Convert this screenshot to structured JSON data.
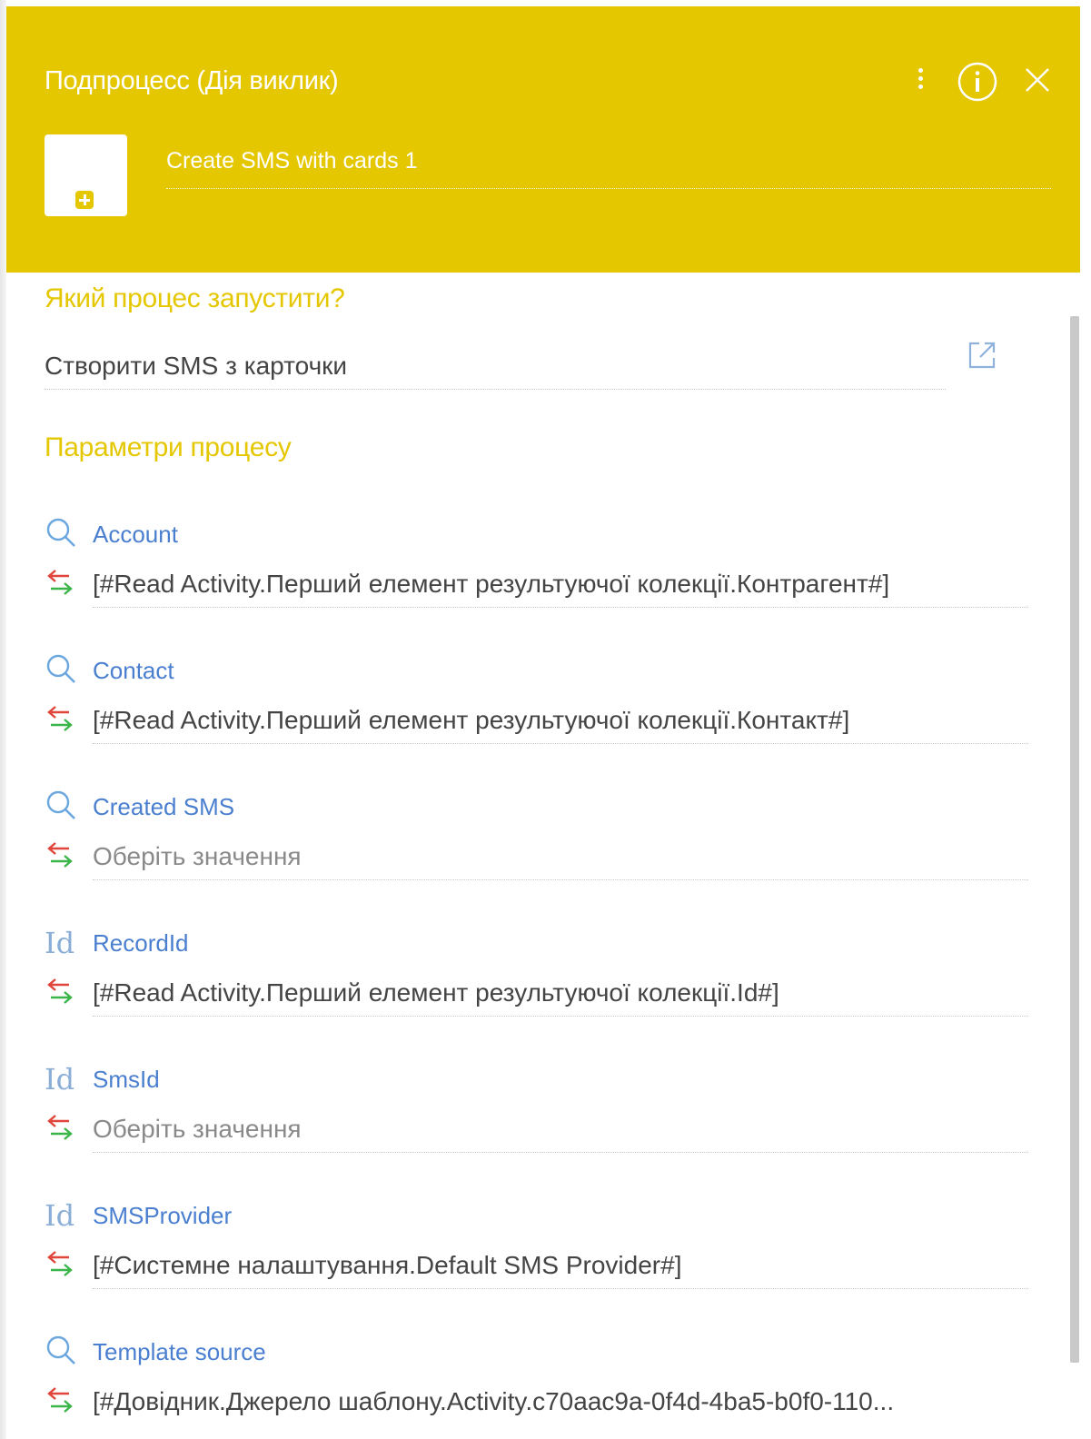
{
  "header": {
    "title": "Подпроцесс (Дія виклик)",
    "element_name": "Create SMS with cards 1",
    "background_color": "#e5c700",
    "icons": [
      "menu-dots-icon",
      "info-icon",
      "close-icon",
      "add-element-icon"
    ]
  },
  "process_section": {
    "title": "Який процес запустити?",
    "selected_process": "Створити SMS з карточки",
    "open_icon": "open-external-icon"
  },
  "parameters_section": {
    "title": "Параметри процесу",
    "params": [
      {
        "name": "Account",
        "icon": "search-icon",
        "value": "[#Read Activity.Перший елемент результуючої колекції.Контрагент#]",
        "placeholder": false
      },
      {
        "name": "Contact",
        "icon": "search-icon",
        "value": "[#Read Activity.Перший елемент результуючої колекції.Контакт#]",
        "placeholder": false
      },
      {
        "name": "Created SMS",
        "icon": "search-icon",
        "value": "Оберіть значення",
        "placeholder": true
      },
      {
        "name": "RecordId",
        "icon": "id-icon",
        "value": "[#Read Activity.Перший елемент результуючої колекції.Id#]",
        "placeholder": false
      },
      {
        "name": "SmsId",
        "icon": "id-icon",
        "value": "Оберіть значення",
        "placeholder": true
      },
      {
        "name": "SMSProvider",
        "icon": "id-icon",
        "value": "[#Системне налаштування.Default SMS Provider#]",
        "placeholder": false
      },
      {
        "name": "Template source",
        "icon": "search-icon",
        "value": "[#Довідник.Джерело шаблону.Activity.c70aac9a-0f4d-4ba5-b0f0-110...",
        "placeholder": false
      }
    ],
    "id_icon_text": "Id",
    "mapping_icon": "mapping-arrows-icon"
  },
  "colors": {
    "accent": "#e5c700",
    "param_name": "#4a7fd0",
    "value_text": "#444444",
    "placeholder_text": "#8a8a8a"
  }
}
